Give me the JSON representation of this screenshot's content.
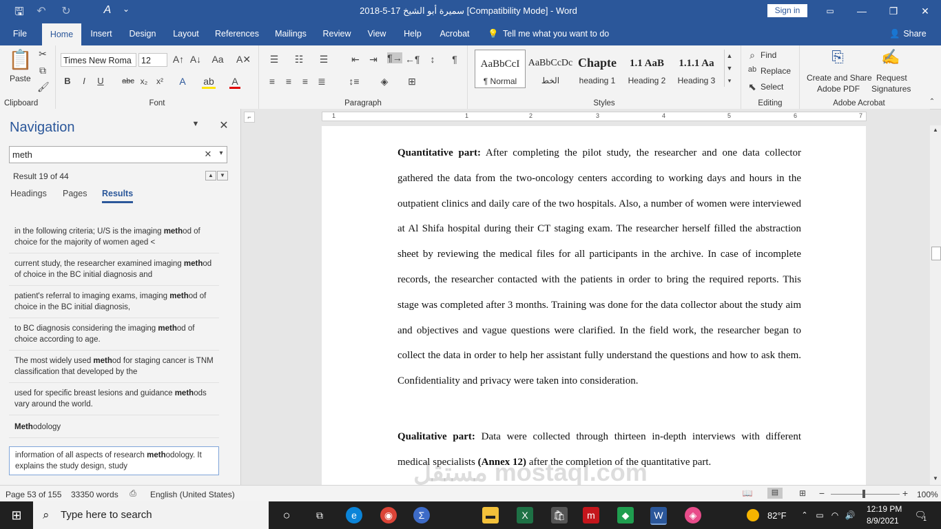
{
  "window": {
    "title": "سميرة أبو الشيخ 17-5-2018 [Compatibility Mode]  -  Word",
    "sign_in": "Sign in",
    "share": "Share",
    "quick_access_more": "⌄"
  },
  "tabs": [
    "File",
    "Home",
    "Insert",
    "Design",
    "Layout",
    "References",
    "Mailings",
    "Review",
    "View",
    "Help",
    "Acrobat"
  ],
  "tell_me": "Tell me what you want to do",
  "ribbon": {
    "clipboard": {
      "paste": "Paste",
      "label": "Clipboard"
    },
    "font": {
      "name": "Times New Roma",
      "size": "12",
      "label": "Font",
      "buttons": [
        "B",
        "I",
        "U",
        "abc",
        "x₂",
        "x²"
      ]
    },
    "paragraph": {
      "label": "Paragraph"
    },
    "styles": {
      "label": "Styles",
      "items": [
        {
          "preview": "AaBbCcI",
          "name": "¶ Normal"
        },
        {
          "preview": "AaBbCcDc",
          "name": "الخط"
        },
        {
          "preview": "Chapte",
          "name": "heading 1"
        },
        {
          "preview": "1.1  AaB",
          "name": "Heading 2"
        },
        {
          "preview": "1.1.1  Aa",
          "name": "Heading 3"
        }
      ]
    },
    "editing": {
      "find": "Find",
      "replace": "Replace",
      "select": "Select",
      "label": "Editing"
    },
    "acrobat": {
      "create_share": "Create and Share",
      "adobe_pdf": "Adobe PDF",
      "request": "Request",
      "signatures": "Signatures",
      "label": "Adobe Acrobat"
    }
  },
  "navigation": {
    "title": "Navigation",
    "search_value": "meth",
    "result_count": "Result 19 of 44",
    "tabs": [
      "Headings",
      "Pages",
      "Results"
    ],
    "results": [
      {
        "pre": "in the following criteria; U/S is the imaging ",
        "hit": "meth",
        "post": "od of choice for the majority of women aged <"
      },
      {
        "pre": "current study, the researcher examined imaging ",
        "hit": "meth",
        "post": "od of choice in the BC initial diagnosis and"
      },
      {
        "pre": "patient's referral to imaging exams, imaging ",
        "hit": "meth",
        "post": "od of choice in the BC initial diagnosis,"
      },
      {
        "pre": "to BC diagnosis considering the imaging ",
        "hit": "meth",
        "post": "od of choice according to age."
      },
      {
        "pre": "The most widely used ",
        "hit": "meth",
        "post": "od for staging cancer is TNM classification that developed by the"
      },
      {
        "pre": "used for specific breast lesions and guidance ",
        "hit": "meth",
        "post": "ods vary around the world."
      },
      {
        "pre": "",
        "hit": "Meth",
        "post": "odology"
      },
      {
        "pre": "information of all aspects of research ",
        "hit": "meth",
        "post": "odology. It explains the study design, study"
      }
    ]
  },
  "document": {
    "para1_bold": "Quantitative part:",
    "para1_text": " After completing the pilot study, the researcher and one data collector gathered the data from the two-oncology centers according to working days and hours in the outpatient clinics and daily care of the two hospitals. Also, a number of women were interviewed at Al Shifa hospital during their CT staging exam. The researcher herself filled the abstraction sheet by reviewing the medical files for all participants in the archive. In case of incomplete records, the researcher contacted with the patients in order to bring the required reports. This stage was completed after 3 months. Training was done for the data collector about the study aim and objectives and vague questions were clarified. In the field work, the researcher began to collect the data in order to help her assistant fully understand the questions and how to ask them. Confidentiality and privacy were taken into consideration.",
    "para2_bold": "Qualitative part:",
    "para2_text": " Data were collected through thirteen in-depth interviews with different medical specialists ",
    "para2_annex": "(Annex 12)",
    "para2_end": " after the completion of the quantitative part.",
    "ruler_numbers": [
      "1",
      "1",
      "2",
      "3",
      "4",
      "5",
      "6",
      "7"
    ]
  },
  "status": {
    "page": "Page 53 of 155",
    "words": "33350 words",
    "language": "English (United States)",
    "zoom": "100%"
  },
  "taskbar": {
    "search_placeholder": "Type here to search",
    "weather": "82°F",
    "time": "12:19 PM",
    "date": "8/9/2021",
    "notification_count": "1"
  },
  "watermark": "مستقل mostaql.com"
}
